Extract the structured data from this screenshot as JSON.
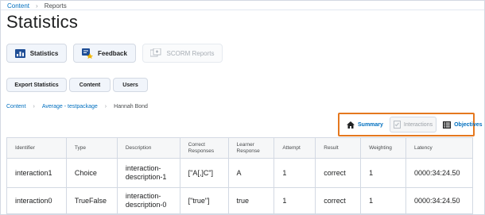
{
  "breadcrumb_top": {
    "link": "Content",
    "current": "Reports"
  },
  "page_title": "Statistics",
  "tool_buttons": {
    "statistics": "Statistics",
    "feedback": "Feedback",
    "scorm_reports": "SCORM Reports"
  },
  "sub_buttons": {
    "export": "Export Statistics",
    "content": "Content",
    "users": "Users"
  },
  "breadcrumb": {
    "root": "Content",
    "middle": "Average - testpackage",
    "current": "Hannah Bond"
  },
  "view_toggle": {
    "summary": "Summary",
    "interactions": "Interactions",
    "objectives": "Objectives"
  },
  "table": {
    "headers": [
      "Identifier",
      "Type",
      "Description",
      "Correct Responses",
      "Learner Response",
      "Attempt",
      "Result",
      "Weighting",
      "Latency"
    ],
    "rows": [
      [
        "interaction1",
        "Choice",
        "interaction-description-1",
        "[\"A[,]C\"]",
        "A",
        "1",
        "correct",
        "1",
        "0000:34:24.50"
      ],
      [
        "interaction0",
        "TrueFalse",
        "interaction-description-0",
        "[\"true\"]",
        "true",
        "1",
        "correct",
        "1",
        "0000:34:24.50"
      ]
    ]
  },
  "colors": {
    "link": "#006fbf",
    "highlight_border": "#e5781f"
  }
}
